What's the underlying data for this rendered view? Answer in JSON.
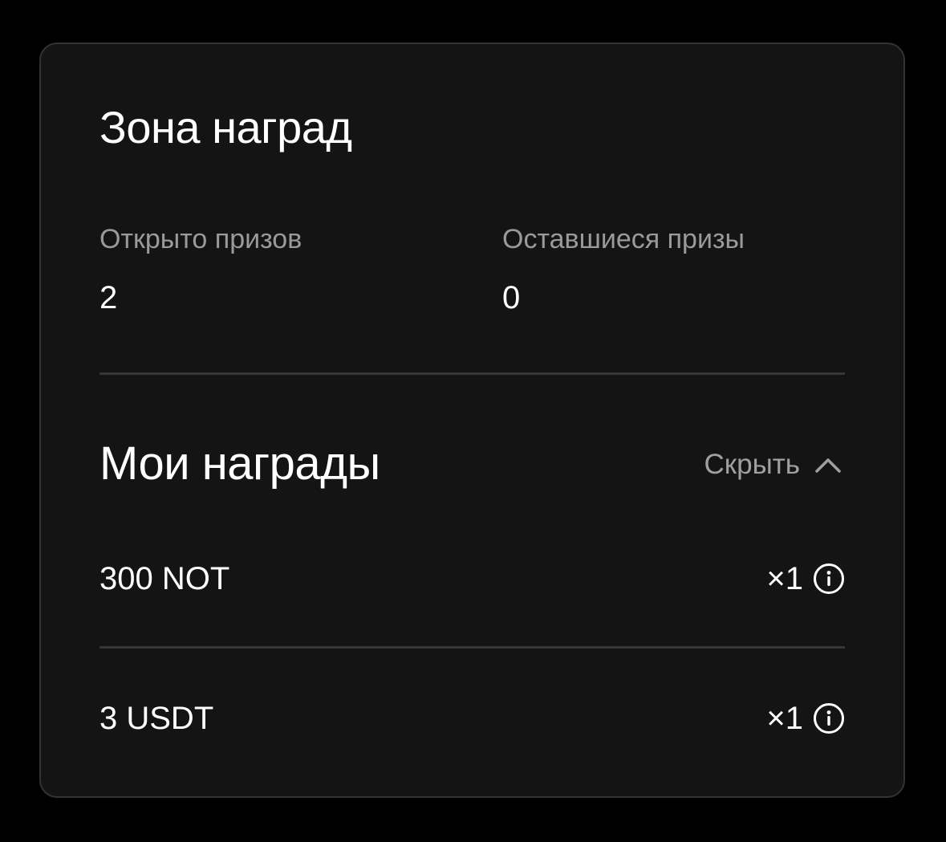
{
  "rewards_zone": {
    "title": "Зона наград",
    "stats": [
      {
        "label": "Открыто призов",
        "value": "2"
      },
      {
        "label": "Оставшиеся призы",
        "value": "0"
      }
    ]
  },
  "my_rewards": {
    "title": "Мои награды",
    "hide_label": "Скрыть",
    "hide_icon": "chevron-up-icon",
    "items": [
      {
        "name": "300 NOT",
        "quantity": "×1",
        "icon": "info-icon"
      },
      {
        "name": "3 USDT",
        "quantity": "×1",
        "icon": "info-icon"
      }
    ]
  },
  "colors": {
    "background": "#000000",
    "card": "#141414",
    "card_border": "#333333",
    "muted_text": "#9a9a9a",
    "divider": "#363636"
  }
}
